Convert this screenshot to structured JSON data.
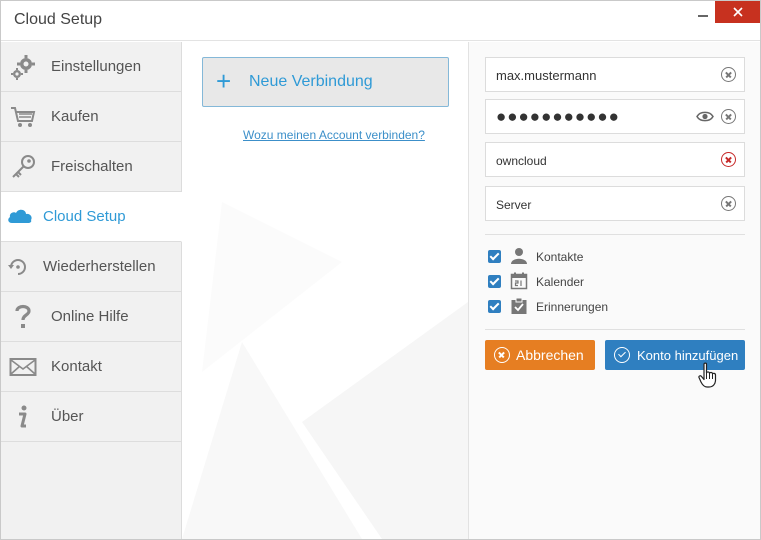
{
  "window": {
    "title": "Cloud Setup"
  },
  "sidebar": {
    "items": [
      {
        "label": "Einstellungen",
        "icon": "gears-icon"
      },
      {
        "label": "Kaufen",
        "icon": "cart-icon"
      },
      {
        "label": "Freischalten",
        "icon": "key-icon"
      },
      {
        "label": "Cloud Setup",
        "icon": "cloud-icon",
        "active": true
      },
      {
        "label": "Wiederherstellen",
        "icon": "restore-icon"
      },
      {
        "label": "Online Hilfe",
        "icon": "question-icon"
      },
      {
        "label": "Kontakt",
        "icon": "envelope-icon"
      },
      {
        "label": "Über",
        "icon": "info-icon"
      }
    ]
  },
  "center": {
    "new_connection_label": "Neue Verbindung",
    "why_link": "Wozu meinen Account verbinden?"
  },
  "form": {
    "username": "max.mustermann",
    "password_mask": "●●●●●●●●●●●",
    "service": "owncloud",
    "server": "Server"
  },
  "sync": {
    "contacts": "Kontakte",
    "calendar": "Kalender",
    "reminders": "Erinnerungen"
  },
  "actions": {
    "cancel": "Abbrechen",
    "add_account": "Konto hinzufügen"
  },
  "colors": {
    "accent": "#2f9ad6",
    "primary_button": "#2f7fc0",
    "cancel_button": "#e67e22",
    "close_button": "#c7311f",
    "error": "#c62828"
  }
}
